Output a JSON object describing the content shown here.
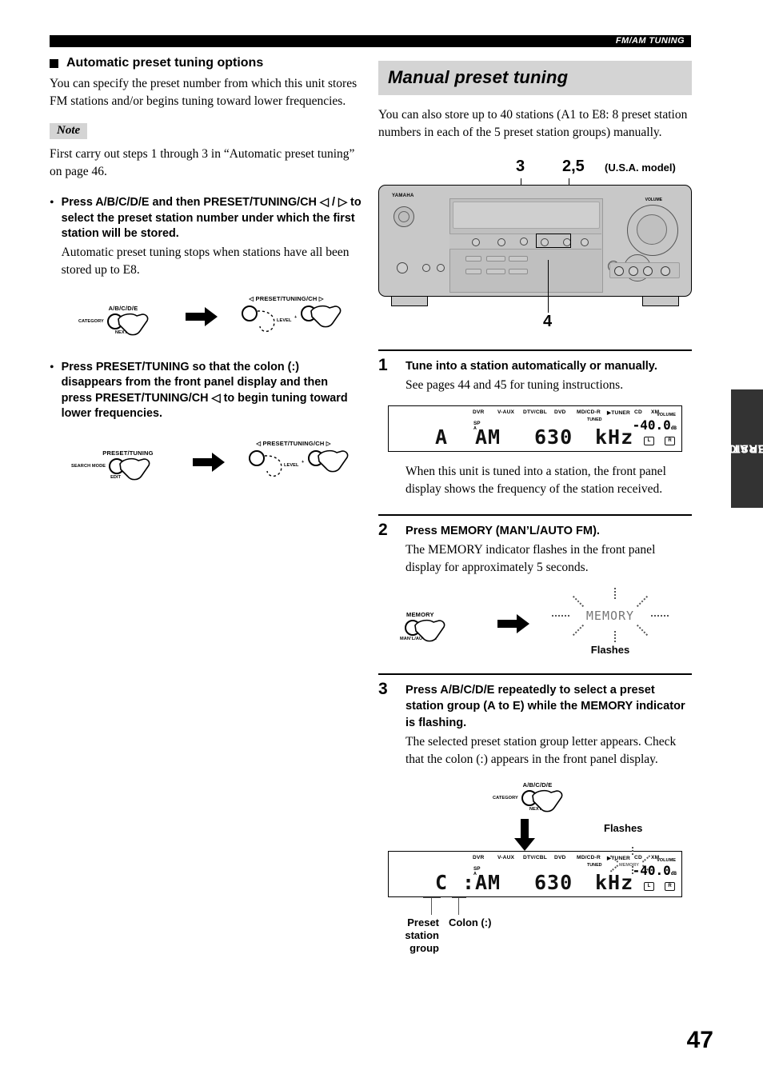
{
  "header": {
    "running_head": "FM/AM TUNING"
  },
  "page_number": "47",
  "side_tab": {
    "line1": "BASIC",
    "line2": "OPERATION"
  },
  "left_column": {
    "section_heading": "Automatic preset tuning options",
    "intro": "You can specify the preset number from which this unit stores FM stations and/or begins tuning toward lower frequencies.",
    "note_label": "Note",
    "note_text": "First carry out steps 1 through 3 in “Automatic preset tuning” on page 46.",
    "bullets": [
      {
        "marker": "•",
        "bold": "Press A/B/C/D/E and then PRESET/TUNING/CH ◁ / ▷ to select the preset station number under which the first station will be stored.",
        "normal": "Automatic preset tuning stops when stations have all been stored up to E8.",
        "diagram": {
          "left_knob": {
            "top_label": "A/B/C/D/E",
            "side_label": "CATEGORY",
            "bottom_label": "NEXT"
          },
          "arrow": "right-arrow",
          "right_group": {
            "top_label": "◁ PRESET/TUNING/CH ▷",
            "center_label": "LEVEL",
            "plus_label": "+"
          }
        }
      },
      {
        "marker": "•",
        "bold": "Press PRESET/TUNING so that the colon (:) disappears from the front panel display and then press PRESET/TUNING/CH ◁ to begin tuning toward lower frequencies.",
        "normal": "",
        "diagram": {
          "left_knob": {
            "top_label": "PRESET/TUNING",
            "side_label": "SEARCH MODE",
            "bottom_label": "EDIT"
          },
          "arrow": "right-arrow",
          "right_group": {
            "top_label": "◁ PRESET/TUNING/CH ▷",
            "center_label": "LEVEL",
            "plus_label": "+"
          }
        }
      }
    ]
  },
  "right_column": {
    "section_title": "Manual preset tuning",
    "intro": "You can also store up to 40 stations (A1 to E8: 8 preset station numbers in each of the 5 preset station groups) manually.",
    "receiver_callouts": {
      "top_left_num": "3",
      "top_right_num": "2,5",
      "model_note": "(U.S.A. model)",
      "bottom_num": "4",
      "brand": "YAMAHA",
      "volume_label": "VOLUME"
    },
    "steps": [
      {
        "num": "1",
        "head": "Tune into a station automatically or manually.",
        "sub": "See pages 44 and 45 for tuning instructions.",
        "after": "When this unit is tuned into a station, the front panel display shows the frequency of the station received."
      },
      {
        "num": "2",
        "head": "Press MEMORY (MAN’L/AUTO FM).",
        "sub": "The MEMORY indicator flashes in the front panel display for approximately 5 seconds.",
        "diagram": {
          "knob": {
            "top_label": "MEMORY",
            "bottom_label": "MAN’L/AUTO FM"
          },
          "flash_word": "MEMORY",
          "caption": "Flashes"
        }
      },
      {
        "num": "3",
        "head": "Press A/B/C/D/E repeatedly to select a preset station group (A to E) while the MEMORY indicator is flashing.",
        "sub": "The selected preset station group letter appears. Check that the colon (:) appears in the front panel display.",
        "diagram": {
          "knob": {
            "top_label": "A/B/C/D/E",
            "side_label": "CATEGORY",
            "bottom_label": "NEXT"
          },
          "flash_caption": "Flashes",
          "label_preset_group": "Preset station group",
          "label_colon": "Colon (:)"
        }
      }
    ],
    "display_step1": {
      "indicators": [
        "DVR",
        "V-AUX",
        "DTV/CBL",
        "DVD",
        "MD/CD-R",
        "▶TUNER",
        "CD",
        "XM"
      ],
      "tuned": "TUNED",
      "sp": "SP",
      "sp_group": "A",
      "volume_label": "VOLUME",
      "volume_value": "-40.0",
      "volume_unit": "dB",
      "main_group": "A",
      "main_band": "AM",
      "main_freq": "630",
      "main_unit": "kHz",
      "left_ch": "L",
      "right_ch": "R"
    },
    "display_step3": {
      "indicators": [
        "DVR",
        "V-AUX",
        "DTV/CBL",
        "DVD",
        "MD/CD-R",
        "▶TUNER",
        "CD",
        "XM"
      ],
      "tuned": "TUNED",
      "memory": "MEMORY",
      "sp": "SP",
      "sp_group": "A",
      "volume_label": "VOLUME",
      "volume_value": "-40.0",
      "volume_unit": "dB",
      "main_group": "C",
      "main_colon": ":",
      "main_band": "AM",
      "main_freq": "630",
      "main_unit": "kHz",
      "left_ch": "L",
      "right_ch": "R"
    }
  }
}
